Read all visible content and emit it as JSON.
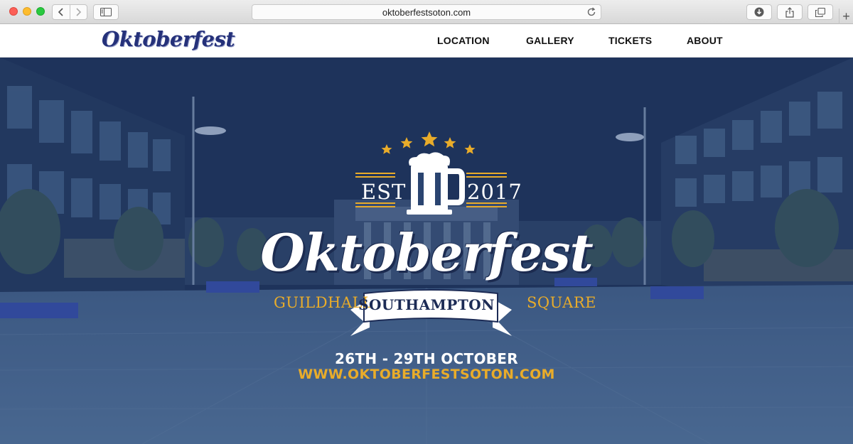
{
  "browser": {
    "url": "oktoberfestsoton.com",
    "new_tab_symbol": "+"
  },
  "site": {
    "logo_text": "Oktoberfest",
    "nav": {
      "location": "LOCATION",
      "gallery": "GALLERY",
      "tickets": "TICKETS",
      "about": "ABOUT"
    }
  },
  "hero": {
    "est_label": "EST",
    "year": "2017",
    "title": "Oktoberfest",
    "left_text": "GUILDHALL",
    "banner_text": "SOUTHAMPTON",
    "right_text": "SQUARE",
    "dates": "26TH - 29TH OCTOBER",
    "website": "WWW.OKTOBERFESTSOTON.COM",
    "star_count": 5
  },
  "colors": {
    "logo_blue": "#25317a",
    "accent_gold": "#e9ac2a",
    "banner_navy": "#1c2b55",
    "overlay_blue": "#2a4470"
  }
}
